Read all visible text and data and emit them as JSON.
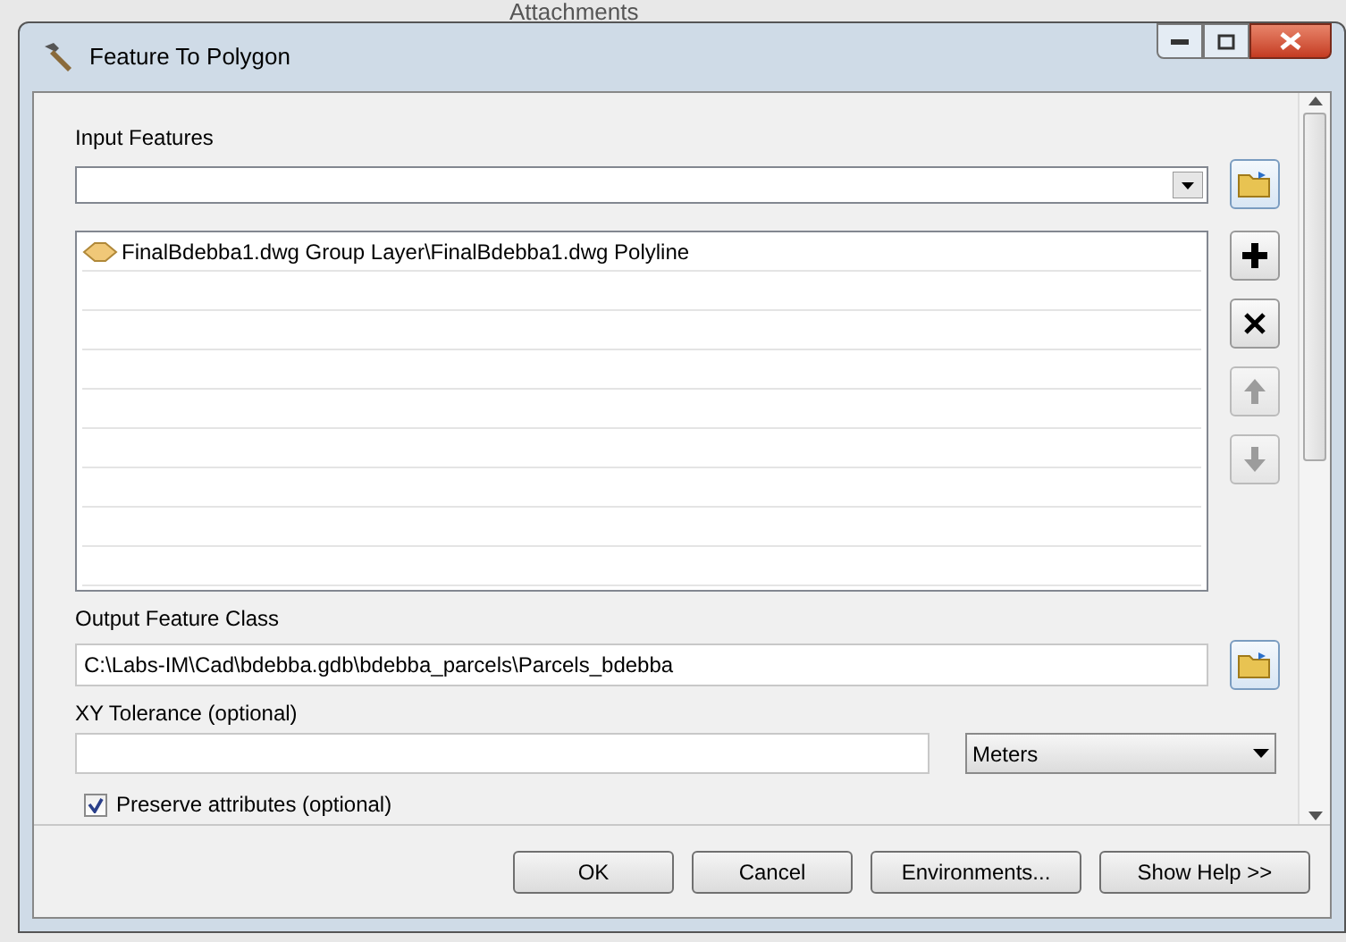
{
  "background": {
    "text": "Attachments"
  },
  "window": {
    "title": "Feature To Polygon"
  },
  "input_features": {
    "label": "Input Features",
    "value_list": [
      {
        "text": "FinalBdebba1.dwg Group Layer\\FinalBdebba1.dwg Polyline"
      }
    ]
  },
  "output": {
    "label": "Output Feature Class",
    "value": "C:\\Labs-IM\\Cad\\bdebba.gdb\\bdebba_parcels\\Parcels_bdebba"
  },
  "tolerance": {
    "label": "XY Tolerance (optional)",
    "unit": "Meters"
  },
  "preserve": {
    "label": "Preserve attributes (optional)",
    "checked": true
  },
  "buttons": [
    {
      "label": "OK"
    },
    {
      "label": "Cancel"
    },
    {
      "label": "Environments..."
    },
    {
      "label": "Show Help >>"
    }
  ]
}
